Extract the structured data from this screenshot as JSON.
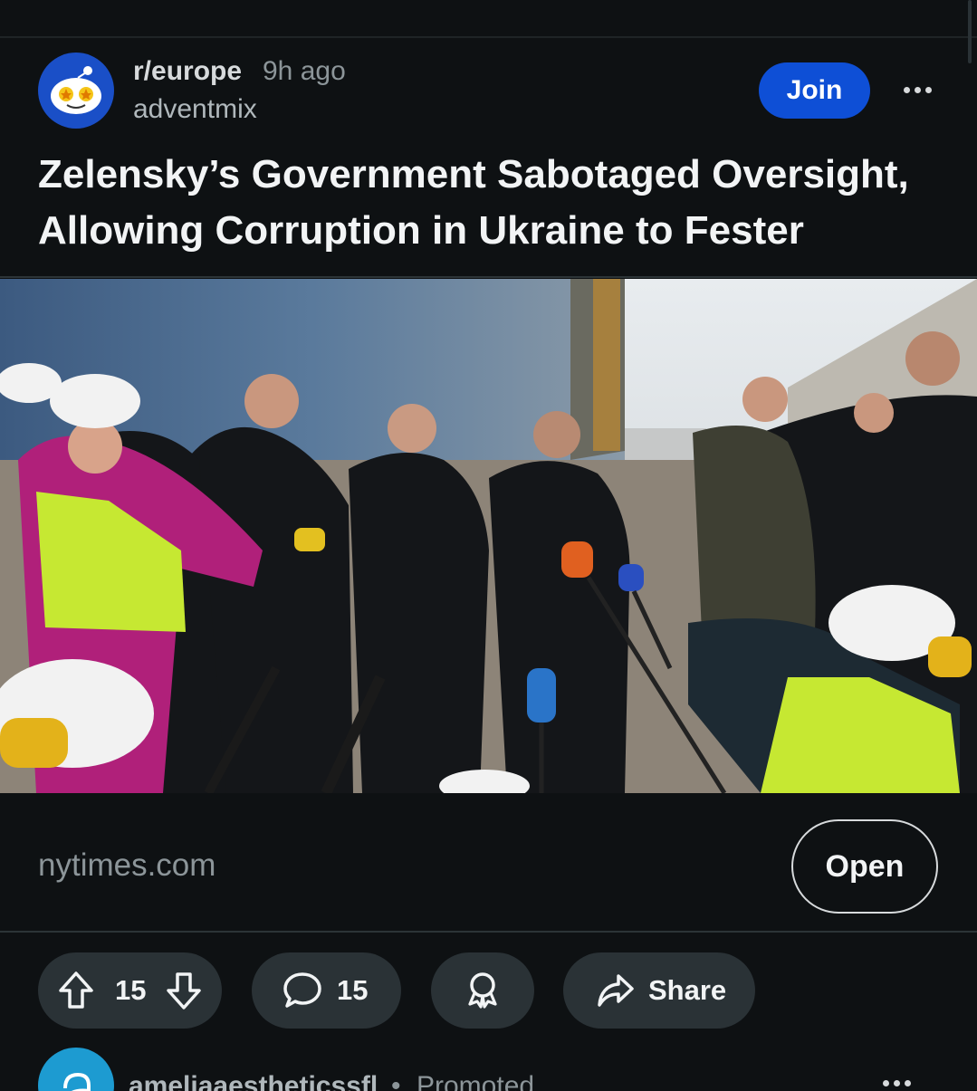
{
  "post": {
    "subreddit": "r/europe",
    "time_ago": "9h ago",
    "author": "adventmix",
    "join_label": "Join",
    "title": "Zelensky’s Government Sabotaged Oversight, Allowing Corruption in Ukraine to Fester"
  },
  "link": {
    "domain": "nytimes.com",
    "open_label": "Open"
  },
  "actions": {
    "vote_count": "15",
    "comment_count": "15",
    "share_label": "Share"
  },
  "next_post": {
    "username": "ameliaaestheticssfl",
    "separator": "•",
    "promoted": "Promoted"
  },
  "icons": {
    "more": "ellipsis-icon",
    "upvote": "arrow-up-icon",
    "downvote": "arrow-down-icon",
    "comment": "speech-bubble-icon",
    "award": "award-icon",
    "share": "share-arrow-icon"
  },
  "colors": {
    "background": "#0e1113",
    "join": "#0e4fd6",
    "pill": "#2a3236",
    "muted_text": "#8c9599"
  }
}
